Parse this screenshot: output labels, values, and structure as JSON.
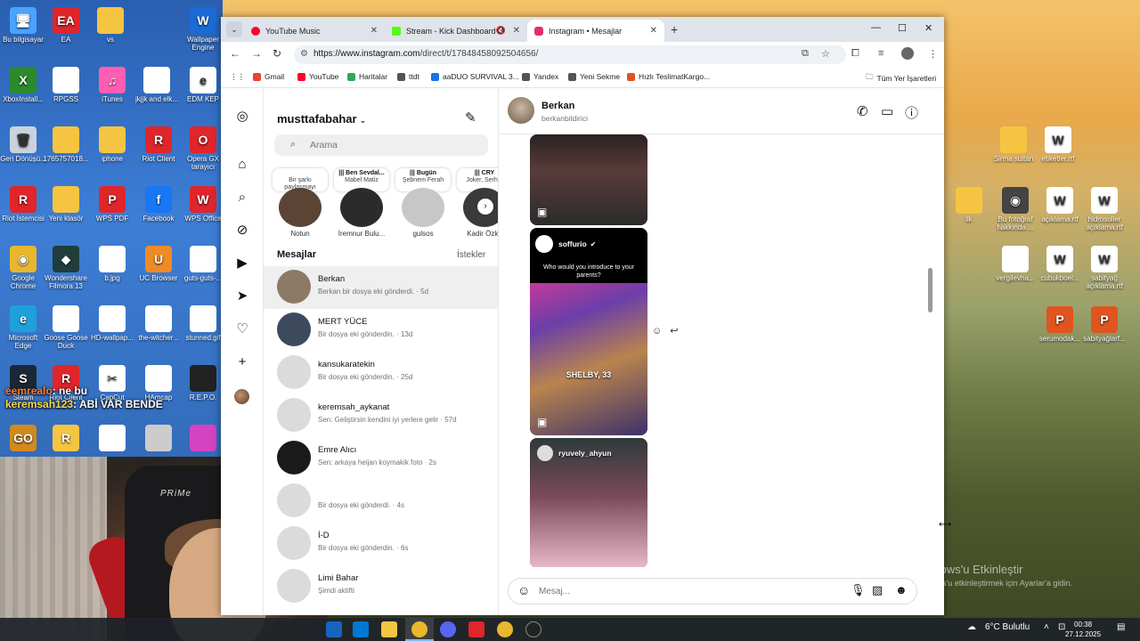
{
  "desktop_icons_left": [
    {
      "label": "Bu bilgisayar",
      "color": "#4aa3ff",
      "glyph": "🖥"
    },
    {
      "label": "EA",
      "color": "#e0252b",
      "glyph": "EA"
    },
    {
      "label": "vs",
      "color": "#f5c542",
      "glyph": ""
    },
    {
      "label": "Wallpaper Engine",
      "color": "#1b6ad6",
      "glyph": "W"
    },
    {
      "label": "XboxInstall...",
      "color": "#2b8a2b",
      "glyph": "X"
    },
    {
      "label": "RPGSS",
      "color": "#ffffff",
      "glyph": ""
    },
    {
      "label": "iTunes",
      "color": "#ff5db1",
      "glyph": "♫"
    },
    {
      "label": "jkjjk and elk...",
      "color": "#ffffff",
      "glyph": ""
    },
    {
      "label": "EDM KEP",
      "color": "#ffffff",
      "glyph": "e"
    },
    {
      "label": "Geri Dönüşü...",
      "color": "#c9d3dd",
      "glyph": "🗑"
    },
    {
      "label": "1765757018...",
      "color": "#f5c542",
      "glyph": ""
    },
    {
      "label": "iphone",
      "color": "#f5c542",
      "glyph": ""
    },
    {
      "label": "Riot Client",
      "color": "#e0252b",
      "glyph": "R"
    },
    {
      "label": "Opera GX tarayıcı",
      "color": "#e0252b",
      "glyph": "O"
    },
    {
      "label": "Riot İstemcisi",
      "color": "#e0252b",
      "glyph": "R"
    },
    {
      "label": "Yeni klasör",
      "color": "#f5c542",
      "glyph": ""
    },
    {
      "label": "WPS PDF",
      "color": "#e0252b",
      "glyph": "P"
    },
    {
      "label": "Facebook",
      "color": "#1877f2",
      "glyph": "f"
    },
    {
      "label": "WPS Office",
      "color": "#e0252b",
      "glyph": "W"
    },
    {
      "label": "Google Chrome",
      "color": "#e8b72d",
      "glyph": "◉"
    },
    {
      "label": "Wondershare Filmora 13",
      "color": "#1f3d3a",
      "glyph": "◆"
    },
    {
      "label": "b.jpg",
      "color": "#ffffff",
      "glyph": ""
    },
    {
      "label": "UC Browser",
      "color": "#f08a24",
      "glyph": "U"
    },
    {
      "label": "guts-guts-...",
      "color": "#ffffff",
      "glyph": ""
    },
    {
      "label": "Microsoft Edge",
      "color": "#1fa0d8",
      "glyph": "e"
    },
    {
      "label": "Goose Goose Duck",
      "color": "#ffffff",
      "glyph": ""
    },
    {
      "label": "HD-wallpap...",
      "color": "#ffffff",
      "glyph": ""
    },
    {
      "label": "the-witcher...",
      "color": "#ffffff",
      "glyph": ""
    },
    {
      "label": "stunned.gif",
      "color": "#ffffff",
      "glyph": ""
    },
    {
      "label": "Steam",
      "color": "#1b2838",
      "glyph": "S"
    },
    {
      "label": "Riot Client",
      "color": "#e0252b",
      "glyph": "R"
    },
    {
      "label": "CapCut",
      "color": "#ffffff",
      "glyph": "✂"
    },
    {
      "label": "HAmcap",
      "color": "#ffffff",
      "glyph": ""
    },
    {
      "label": "R.E.P.O.",
      "color": "#222222",
      "glyph": ""
    },
    {
      "label": "",
      "color": "#d18a1e",
      "glyph": "GO"
    },
    {
      "label": "",
      "color": "#f5c542",
      "glyph": "R"
    },
    {
      "label": "",
      "color": "#ffffff",
      "glyph": ""
    },
    {
      "label": "",
      "color": "#cccccc",
      "glyph": ""
    },
    {
      "label": "",
      "color": "#d443c2",
      "glyph": ""
    }
  ],
  "desktop_icons_right": [
    {
      "label": "Sirma sultan",
      "color": "#f5c542",
      "glyph": ""
    },
    {
      "label": "etiketler.rtf",
      "color": "#ffffff",
      "glyph": "W"
    },
    {
      "label": "ilk",
      "color": "#f5c542",
      "glyph": ""
    },
    {
      "label": "Bu fotoğraf hakkında ...",
      "color": "#444444",
      "glyph": "◉"
    },
    {
      "label": "açıklama.rtf",
      "color": "#ffffff",
      "glyph": "W"
    },
    {
      "label": "hidrosoller açıklama.rtf",
      "color": "#ffffff",
      "glyph": "W"
    },
    {
      "label": "vergilevha...",
      "color": "#ffffff",
      "glyph": ""
    },
    {
      "label": "cubukboel...",
      "color": "#ffffff",
      "glyph": "W"
    },
    {
      "label": "sabityağ açıklama.rtf",
      "color": "#ffffff",
      "glyph": "W"
    },
    {
      "label": "serumodak...",
      "color": "#e0541f",
      "glyph": "P"
    },
    {
      "label": "sabityağlarf...",
      "color": "#e0541f",
      "glyph": "P"
    }
  ],
  "stream_chat": [
    {
      "user": "eemrealo",
      "text": ": ne bu"
    },
    {
      "user": "keremsah123",
      "text": ": ABİ VAR BENDE"
    }
  ],
  "webcam": {
    "chair_brand": "PRiMe"
  },
  "browser": {
    "tabs": [
      {
        "title": "YouTube Music",
        "color": "#ff0033"
      },
      {
        "title": "Stream - Kick Dashboard",
        "color": "#53fc18"
      },
      {
        "title": "Instagram • Mesajlar",
        "color": "#e1306c"
      }
    ],
    "url_host": "https://www.instagram.com",
    "url_path": "/direct/t/17848458092504656/",
    "bookmarks": [
      {
        "label": "Gmail",
        "color": "#ea4335"
      },
      {
        "label": "YouTube",
        "color": "#ff0033"
      },
      {
        "label": "Haritalar",
        "color": "#34a853"
      },
      {
        "label": "ttdt",
        "color": "#555555"
      },
      {
        "label": "aaDUO SURVIVAL 3...",
        "color": "#1a73e8"
      },
      {
        "label": "Yandex",
        "color": "#555555"
      },
      {
        "label": "Yeni Sekme",
        "color": "#555555"
      },
      {
        "label": "Hızlı TeslimatKargo...",
        "color": "#e0541f"
      }
    ],
    "bookmarks_folder": "Tüm Yer İşaretleri"
  },
  "instagram": {
    "username": "musttafabahar",
    "search_placeholder": "Arama",
    "notes": [
      {
        "bubble_text": "Bir şarkı paylaşmayı dene...",
        "bubble_title": "",
        "name": "Notun",
        "pic": "#5b4433"
      },
      {
        "bubble_text": "Mabel Matiz",
        "bubble_title": "||| Ben Sevdal...",
        "name": "İremnur Bulu...",
        "pic": "#2b2b2b"
      },
      {
        "bubble_text": "Şebnem Ferah",
        "bubble_title": "||| Bugün",
        "name": "gulsos",
        "pic": "#c7c7c7"
      },
      {
        "bubble_text": "Joker, Serhat",
        "bubble_title": "||| CRY",
        "name": "Kadir Özka",
        "pic": "#3a3a3a"
      }
    ],
    "messages_heading": "Mesajlar",
    "requests_label": "İstekler",
    "conversations": [
      {
        "name": "Berkan",
        "preview": "Berkan bir dosya eki gönderdi. · 5d",
        "avatar": "#8c7a66"
      },
      {
        "name": "MERT YÜCE",
        "preview": "Bir dosya eki gönderdin. · 13d",
        "avatar": "#3d4a5e"
      },
      {
        "name": "kansukaratekin",
        "preview": "Bir dosya eki gönderdin. · 25d",
        "avatar": "#dbdbdb"
      },
      {
        "name": "keremsah_aykanat",
        "preview": "Sen: Geliştirsin kendini iyi yerlere gelir · 57d",
        "avatar": "#dbdbdb"
      },
      {
        "name": "Emre Alıcı",
        "preview": "Sen: arkaya heijan koymakik foto · 2s",
        "avatar": "#1a1a1a"
      },
      {
        "name": "",
        "preview": "Bir dosya eki gönderdi. · 4s",
        "avatar": "#dbdbdb"
      },
      {
        "name": "İ-D",
        "preview": "Bir dosya eki gönderdin. · 6s",
        "avatar": "#dbdbdb"
      },
      {
        "name": "Limi Bahar",
        "preview": "Şimdi aktifti",
        "avatar": "#dbdbdb"
      }
    ],
    "chat": {
      "name": "Berkan",
      "username": "berkanbildirici",
      "reel2_user": "soffurio",
      "reel2_caption": "Who would you introduce to your parents?",
      "reel2_overlay": "SHELBY, 33",
      "reel3_user": "ryuvely_ahyun",
      "composer_placeholder": "Mesaj..."
    }
  },
  "windows_activation": {
    "line1": "Windows'u Etkinleştir",
    "line2": "Windows'u etkinleştirmek için Ayarlar'a gidin."
  },
  "taskbar": {
    "weather": "6°C Bulutlu",
    "time": "00:38",
    "date": "27.12.2025"
  }
}
